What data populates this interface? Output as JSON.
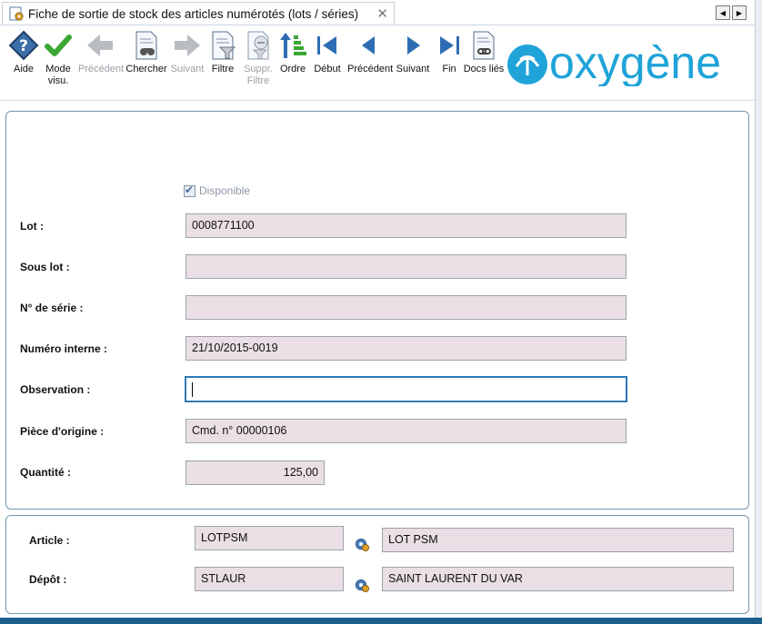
{
  "tab": {
    "title": "Fiche de sortie de stock des articles numérotés (lots / séries)",
    "close": "✕"
  },
  "toolbar": {
    "aide": "Aide",
    "mode_visu": "Mode visu.",
    "precedent_disabled": "Précédent",
    "chercher": "Chercher",
    "suivant_disabled": "Suivant",
    "filtre": "Filtre",
    "suppr_filtre": "Suppr. Filtre",
    "ordre": "Ordre",
    "debut": "Début",
    "precedent": "Précédent",
    "suivant": "Suivant",
    "fin": "Fin",
    "docs_lies": "Docs liés"
  },
  "logo_text": "oxygène",
  "form": {
    "disponible": {
      "label": "Disponible",
      "checked": true
    },
    "lot": {
      "label": "Lot :",
      "value": "0008771100"
    },
    "sous_lot": {
      "label": "Sous lot :",
      "value": ""
    },
    "num_serie": {
      "label": "N° de série :",
      "value": ""
    },
    "numero_interne": {
      "label": "Numéro interne :",
      "value": "21/10/2015-0019"
    },
    "observation": {
      "label": "Observation :",
      "value": ""
    },
    "piece_origine": {
      "label": "Pièce d'origine :",
      "value": "Cmd. n° 00000106"
    },
    "quantite": {
      "label": "Quantité  :",
      "value": "125,00"
    }
  },
  "bottom": {
    "article": {
      "label": "Article :",
      "code": "LOTPSM",
      "name": "LOT PSM"
    },
    "depot": {
      "label": "Dépôt :",
      "code": "STLAUR",
      "name": "SAINT LAURENT DU VAR"
    }
  },
  "colors": {
    "accent": "#2f79b5",
    "field_bg": "#e9dfe4",
    "logo": "#1fa3d8",
    "panel_border": "#6f97ad"
  }
}
